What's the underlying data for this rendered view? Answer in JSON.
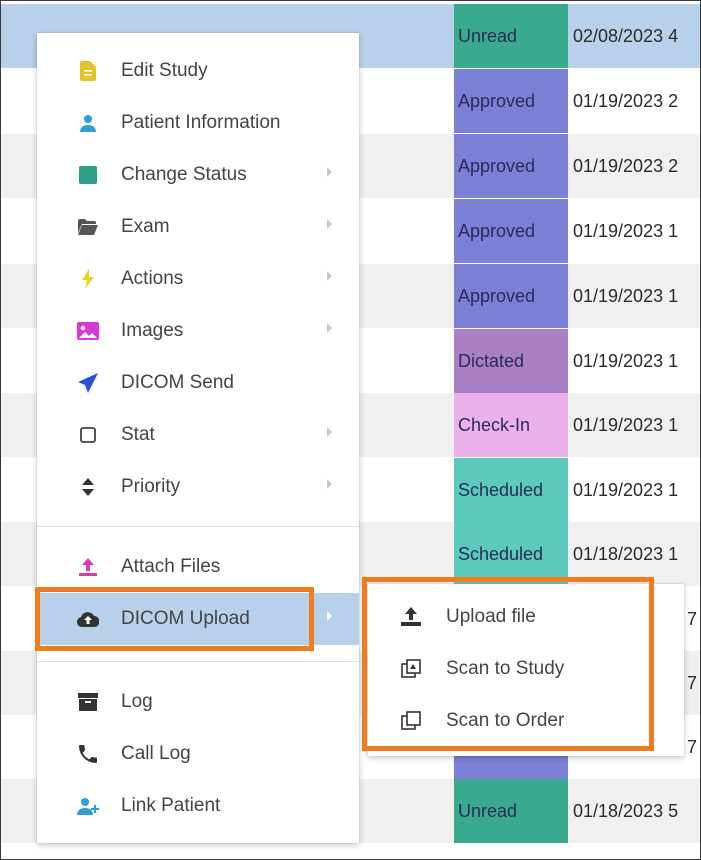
{
  "table": {
    "rows": [
      {
        "status": "Unread",
        "status_color": "#3aaa8f",
        "date": "02/08/2023 4",
        "row_style": "sel"
      },
      {
        "status": "Approved",
        "status_color": "#7b80d6",
        "date": "01/19/2023 2",
        "row_style": "white"
      },
      {
        "status": "Approved",
        "status_color": "#7b80d6",
        "date": "01/19/2023 2",
        "row_style": "alt"
      },
      {
        "status": "Approved",
        "status_color": "#7b80d6",
        "date": "01/19/2023 1",
        "row_style": "white"
      },
      {
        "status": "Approved",
        "status_color": "#7b80d6",
        "date": "01/19/2023 1",
        "row_style": "alt"
      },
      {
        "status": "Dictated",
        "status_color": "#a97fc6",
        "date": "01/19/2023 1",
        "row_style": "white"
      },
      {
        "status": "Check-In",
        "status_color": "#ebb1ea",
        "date": "01/19/2023 1",
        "row_style": "alt"
      },
      {
        "status": "Scheduled",
        "status_color": "#5cc9bd",
        "date": "01/19/2023 1",
        "row_style": "white"
      },
      {
        "status": "Scheduled",
        "status_color": "#5cc9bd",
        "date": "01/18/2023 1",
        "row_style": "alt"
      }
    ],
    "bottom_row": {
      "status": "Unread",
      "status_color": "#3aaa8f",
      "date": "01/18/2023 5"
    },
    "peek_values": [
      "7",
      "7",
      "7"
    ]
  },
  "menu": {
    "items": [
      {
        "label": "Edit Study",
        "icon": "file-icon",
        "color": "#e5c42a",
        "submenu": false
      },
      {
        "label": "Patient Information",
        "icon": "person-icon",
        "color": "#2f9fd6",
        "submenu": false
      },
      {
        "label": "Change Status",
        "icon": "square-icon",
        "color": "#2e9c87",
        "submenu": true
      },
      {
        "label": "Exam",
        "icon": "folder-open-icon",
        "color": "#555555",
        "submenu": true
      },
      {
        "label": "Actions",
        "icon": "lightning-icon",
        "color": "#e8d21c",
        "submenu": true
      },
      {
        "label": "Images",
        "icon": "image-icon",
        "color": "#d83ad2",
        "submenu": true
      },
      {
        "label": "DICOM Send",
        "icon": "send-icon",
        "color": "#2b4fd8",
        "submenu": false
      },
      {
        "label": "Stat",
        "icon": "checkbox-icon",
        "color": "#444444",
        "submenu": true
      },
      {
        "label": "Priority",
        "icon": "sort-icon",
        "color": "#333333",
        "submenu": true
      }
    ],
    "items2": [
      {
        "label": "Attach Files",
        "icon": "upload-icon",
        "color": "#d83ab8"
      },
      {
        "label": "DICOM Upload",
        "icon": "cloud-upload-icon",
        "color": "#333333",
        "active": true
      }
    ],
    "items3": [
      {
        "label": "Log",
        "icon": "archive-icon",
        "color": "#333333"
      },
      {
        "label": "Call Log",
        "icon": "phone-icon",
        "color": "#333333"
      },
      {
        "label": "Link Patient",
        "icon": "person-add-icon",
        "color": "#2f9fd6"
      }
    ]
  },
  "submenu": {
    "items": [
      {
        "label": "Upload file",
        "icon": "upload-file-icon"
      },
      {
        "label": "Scan to Study",
        "icon": "scan-study-icon"
      },
      {
        "label": "Scan to Order",
        "icon": "scan-order-icon"
      }
    ]
  },
  "colors": {
    "highlight": "#f07c1e",
    "selected_row": "#b9d0ea"
  }
}
